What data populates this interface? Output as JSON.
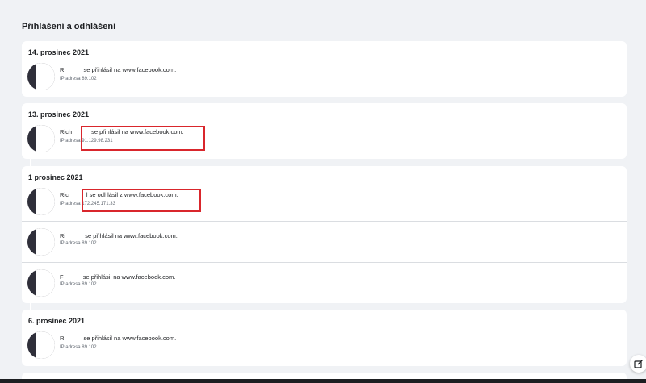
{
  "section_title": "Přihlášení a odhlášení",
  "groups": [
    {
      "date": "14. prosinec 2021",
      "entries": [
        {
          "name": "R",
          "name_tail": "",
          "action": "se přihlásil na www.facebook.com.",
          "ip": "IP adresa 89.102"
        }
      ]
    },
    {
      "date": "13. prosinec 2021",
      "entries": [
        {
          "name": "Rich",
          "name_tail": "",
          "action": "se přihlásil na www.facebook.com.",
          "ip": "IP adresa 91.129.98.231"
        }
      ]
    },
    {
      "date": "1 prosinec 2021",
      "entries": [
        {
          "name": "Ric",
          "name_tail": "l",
          "action": "se odhlásil z www.facebook.com.",
          "ip": "IP adresa 172.245.171.33"
        },
        {
          "name": "Ri",
          "name_tail": "",
          "action": "se přihlásil na www.facebook.com.",
          "ip": "IP adresa 89.102."
        },
        {
          "name": "F",
          "name_tail": "",
          "action": "se přihlásil na www.facebook.com.",
          "ip": "IP adresa 89.102."
        }
      ]
    },
    {
      "date": "6. prosinec 2021",
      "entries": [
        {
          "name": "R",
          "name_tail": "",
          "action": "se přihlásil na www.facebook.com.",
          "ip": "IP adresa 89.102."
        }
      ]
    }
  ],
  "icons": {
    "edit": "compose-icon"
  },
  "colors": {
    "highlight": "#d9262c",
    "background": "#f0f2f5",
    "card": "#ffffff"
  }
}
